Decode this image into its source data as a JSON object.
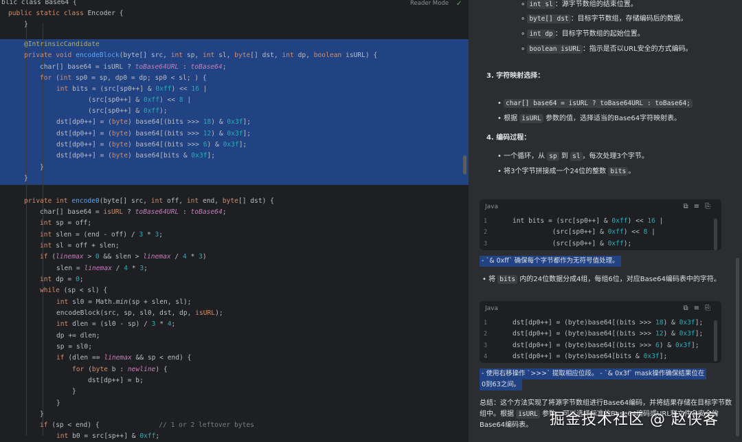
{
  "editor": {
    "reader_mode": "Reader Mode",
    "lines": [
      [
        [
          "",
          "blic class Base64 {"
        ]
      ],
      [
        [
          "kw",
          "public static class "
        ],
        [
          "",
          "Encoder {"
        ]
      ],
      [
        [
          "",
          "}"
        ]
      ],
      [
        [
          "",
          ""
        ]
      ],
      [
        [
          "ann",
          "@IntrinsicCandidate"
        ]
      ],
      [
        [
          "kw",
          "private void "
        ],
        [
          "fn",
          "encodeBlock"
        ],
        [
          "",
          "(byte[] src, "
        ],
        [
          "kw",
          "int "
        ],
        [
          "",
          "sp, "
        ],
        [
          "kw",
          "int "
        ],
        [
          "",
          "sl, "
        ],
        [
          "kw",
          "byte"
        ],
        [
          "",
          "[] dst, "
        ],
        [
          "kw",
          "int "
        ],
        [
          "",
          "dp, "
        ],
        [
          "kw",
          "boolean "
        ],
        [
          "",
          "isURL) {"
        ]
      ],
      [
        [
          "",
          "char[] base64 = isURL ? "
        ],
        [
          "fld",
          "toBase64URL"
        ],
        [
          "",
          " : "
        ],
        [
          "fld",
          "toBase64"
        ],
        [
          "",
          ";"
        ]
      ],
      [
        [
          "kw",
          "for "
        ],
        [
          "",
          "("
        ],
        [
          "kw",
          "int "
        ],
        [
          "",
          "sp0 = sp, dp0 = dp; sp0 < sl; ) {"
        ]
      ],
      [
        [
          "kw",
          "int "
        ],
        [
          "",
          "bits = (src[sp0++] & "
        ],
        [
          "num",
          "0xff"
        ],
        [
          "",
          ") << "
        ],
        [
          "num",
          "16"
        ],
        [
          "",
          " |"
        ]
      ],
      [
        [
          "",
          "(src[sp0++] & "
        ],
        [
          "num",
          "0xff"
        ],
        [
          "",
          ") << "
        ],
        [
          "num",
          "8"
        ],
        [
          "",
          " |"
        ]
      ],
      [
        [
          "",
          "(src[sp0++] & "
        ],
        [
          "num",
          "0xff"
        ],
        [
          "",
          ");"
        ]
      ],
      [
        [
          "",
          "dst[dp0++] = ("
        ],
        [
          "kw",
          "byte"
        ],
        [
          "",
          ") base64[(bits >>> "
        ],
        [
          "num",
          "18"
        ],
        [
          "",
          ") & "
        ],
        [
          "num",
          "0x3f"
        ],
        [
          "",
          "];"
        ]
      ],
      [
        [
          "",
          "dst[dp0++] = ("
        ],
        [
          "kw",
          "byte"
        ],
        [
          "",
          ") base64[(bits >>> "
        ],
        [
          "num",
          "12"
        ],
        [
          "",
          ") & "
        ],
        [
          "num",
          "0x3f"
        ],
        [
          "",
          "];"
        ]
      ],
      [
        [
          "",
          "dst[dp0++] = ("
        ],
        [
          "kw",
          "byte"
        ],
        [
          "",
          ") base64[(bits >>> "
        ],
        [
          "num",
          "6"
        ],
        [
          "",
          ") & "
        ],
        [
          "num",
          "0x3f"
        ],
        [
          "",
          "];"
        ]
      ],
      [
        [
          "",
          "dst[dp0++] = ("
        ],
        [
          "kw",
          "byte"
        ],
        [
          "",
          ") base64[bits & "
        ],
        [
          "num",
          "0x3f"
        ],
        [
          "",
          "];"
        ]
      ],
      [
        [
          "",
          "}"
        ]
      ],
      [
        [
          "",
          "}"
        ]
      ],
      [
        [
          "",
          ""
        ]
      ],
      [
        [
          "kw",
          "private int "
        ],
        [
          "fn",
          "encode0"
        ],
        [
          "",
          "(byte[] src, "
        ],
        [
          "kw",
          "int "
        ],
        [
          "",
          "off, "
        ],
        [
          "kw",
          "int "
        ],
        [
          "",
          "end, "
        ],
        [
          "kw",
          "byte"
        ],
        [
          "",
          "[] dst) {"
        ]
      ],
      [
        [
          "",
          "char[] base64 = "
        ],
        [
          "kw",
          "isURL"
        ],
        [
          "",
          " ? "
        ],
        [
          "fld",
          "toBase64URL"
        ],
        [
          "",
          " : "
        ],
        [
          "fld",
          "toBase64"
        ],
        [
          "",
          ";"
        ]
      ],
      [
        [
          "kw",
          "int "
        ],
        [
          "",
          "sp = off;"
        ]
      ],
      [
        [
          "kw",
          "int "
        ],
        [
          "",
          "slen = (end - off) / "
        ],
        [
          "num",
          "3"
        ],
        [
          "",
          " * "
        ],
        [
          "num",
          "3"
        ],
        [
          "",
          ";"
        ]
      ],
      [
        [
          "kw",
          "int "
        ],
        [
          "",
          "sl = off + slen;"
        ]
      ],
      [
        [
          "kw",
          "if "
        ],
        [
          "",
          "("
        ],
        [
          "fld",
          "linemax"
        ],
        [
          "",
          " > "
        ],
        [
          "num",
          "0"
        ],
        [
          "",
          " && slen > "
        ],
        [
          "fld",
          "linemax"
        ],
        [
          "",
          " / "
        ],
        [
          "num",
          "4"
        ],
        [
          "",
          " * "
        ],
        [
          "num",
          "3"
        ],
        [
          "",
          ")"
        ]
      ],
      [
        [
          "",
          "slen = "
        ],
        [
          "fld",
          "linemax"
        ],
        [
          "",
          " / "
        ],
        [
          "num",
          "4"
        ],
        [
          "",
          " * "
        ],
        [
          "num",
          "3"
        ],
        [
          "",
          ";"
        ]
      ],
      [
        [
          "kw",
          "int "
        ],
        [
          "",
          "dp = "
        ],
        [
          "num",
          "0"
        ],
        [
          "",
          ";"
        ]
      ],
      [
        [
          "kw",
          "while "
        ],
        [
          "",
          "(sp < sl) {"
        ]
      ],
      [
        [
          "kw",
          "int "
        ],
        [
          "",
          "sl0 = Math."
        ],
        [
          "sfn",
          "min"
        ],
        [
          "",
          "(sp + slen, sl);"
        ]
      ],
      [
        [
          "",
          "encodeBlock(src, sp, sl0, dst, dp, "
        ],
        [
          "kw",
          "isURL"
        ],
        [
          "",
          ");"
        ]
      ],
      [
        [
          "kw",
          "int "
        ],
        [
          "",
          "dlen = (sl0 - sp) / "
        ],
        [
          "num",
          "3"
        ],
        [
          "",
          " * "
        ],
        [
          "num",
          "4"
        ],
        [
          "",
          ";"
        ]
      ],
      [
        [
          "",
          "dp += dlen;"
        ]
      ],
      [
        [
          "",
          "sp = sl0;"
        ]
      ],
      [
        [
          "kw",
          "if "
        ],
        [
          "",
          "(dlen == "
        ],
        [
          "fld",
          "linemax"
        ],
        [
          "",
          " && sp < end) {"
        ]
      ],
      [
        [
          "kw",
          "for "
        ],
        [
          "",
          "("
        ],
        [
          "kw",
          "byte "
        ],
        [
          "",
          "b : "
        ],
        [
          "fld",
          "newline"
        ],
        [
          "",
          ") {"
        ]
      ],
      [
        [
          "",
          "dst[dp++] = b;"
        ]
      ],
      [
        [
          "",
          "}"
        ]
      ],
      [
        [
          "",
          "}"
        ]
      ],
      [
        [
          "",
          "}"
        ]
      ],
      [
        [
          "kw",
          "if "
        ],
        [
          "",
          "(sp < end) {               "
        ],
        [
          "cmt",
          "// 1 or 2 leftover bytes"
        ]
      ],
      [
        [
          "kw",
          "int "
        ],
        [
          "",
          "b0 = src[sp++] & "
        ],
        [
          "num",
          "0xff"
        ],
        [
          "",
          ";"
        ]
      ]
    ]
  },
  "panel": {
    "params": [
      {
        "code": "int sl",
        "text": "：源字节数组的结束位置。"
      },
      {
        "code": "byte[] dst",
        "text": "：目标字节数组，存储编码后的数据。"
      },
      {
        "code": "int dp",
        "text": "：目标字节数组的起始位置。"
      },
      {
        "code": "boolean isURL",
        "text": "：指示是否以URL安全的方式编码。"
      }
    ],
    "sec3_title": "3. 字符映射选择：",
    "sec3_b1_code": "char[] base64 = isURL ? toBase64URL : toBase64;",
    "sec3_b2_pre": "根据",
    "sec3_b2_code": "isURL",
    "sec3_b2_post": "参数的值，选择适当的Base64字符映射表。",
    "sec4_title": "4. 编码过程：",
    "sec4_b1_pre": "一个循环，从",
    "sec4_b1_c1": "sp",
    "sec4_b1_mid": "到",
    "sec4_b1_c2": "sl",
    "sec4_b1_post": "，每次处理3个字节。",
    "sec4_b2_pre": "将3个字节拼接成一个24位的整数",
    "sec4_b2_code": "bits",
    "sec4_b2_post": "。",
    "card1": {
      "lang": "Java",
      "rows": [
        {
          "n": "1",
          "code": [
            [
              "",
              "int bits = (src[sp0++] & "
            ],
            [
              "num",
              "0xff"
            ],
            [
              "",
              ") << "
            ],
            [
              "num",
              "16"
            ],
            [
              "",
              " |"
            ]
          ]
        },
        {
          "n": "2",
          "code": [
            [
              "",
              "          (src[sp0++] & "
            ],
            [
              "num",
              "0xff"
            ],
            [
              "",
              ") << "
            ],
            [
              "num",
              "8"
            ],
            [
              "",
              " |"
            ]
          ]
        },
        {
          "n": "3",
          "code": [
            [
              "",
              "          (src[sp0++] & "
            ],
            [
              "num",
              "0xff"
            ],
            [
              "",
              ");"
            ]
          ]
        }
      ]
    },
    "note1": "- `& 0xff` 确保每个字节都作为无符号值处理。",
    "bits_bullet_pre": "将",
    "bits_bullet_code": "bits",
    "bits_bullet_post": "内的24位数据分成4组，每组6位，对应Base64编码表中的字符。",
    "card2": {
      "lang": "Java",
      "rows": [
        {
          "n": "1",
          "code": [
            [
              "",
              "dst[dp0++] = (byte)base64[(bits >>> "
            ],
            [
              "num",
              "18"
            ],
            [
              "",
              ") & "
            ],
            [
              "num",
              "0x3f"
            ],
            [
              "",
              "];"
            ]
          ]
        },
        {
          "n": "2",
          "code": [
            [
              "",
              "dst[dp0++] = (byte)base64[(bits >>> "
            ],
            [
              "num",
              "12"
            ],
            [
              "",
              ") & "
            ],
            [
              "num",
              "0x3f"
            ],
            [
              "",
              "];"
            ]
          ]
        },
        {
          "n": "3",
          "code": [
            [
              "",
              "dst[dp0++] = (byte)base64[(bits >>> "
            ],
            [
              "num",
              "6"
            ],
            [
              "",
              ") & "
            ],
            [
              "num",
              "0x3f"
            ],
            [
              "",
              "];"
            ]
          ]
        },
        {
          "n": "4",
          "code": [
            [
              "",
              "dst[dp0++] = (byte)base64[bits & "
            ],
            [
              "num",
              "0x3f"
            ],
            [
              "",
              "];"
            ]
          ]
        }
      ]
    },
    "note2_line1": "- 使用右移操作 `>>>` 提取相应位段。 - `& 0x3f` mask操作确保结果位在",
    "note2_line2": "0到63之间。",
    "summary_line1": "总结：这个方法实现了将源字节数组进行Base64编码，并将结果存储在目标字节数",
    "summary_line2_pre": "组中。根据",
    "summary_line2_code": "isURL",
    "summary_line2_post": "参数，可以选择标准的Base64编码或URL和文件名安全的",
    "summary_line3": "Base64编码表。"
  },
  "watermark": "掘金技术社区 @ 赵侠客"
}
